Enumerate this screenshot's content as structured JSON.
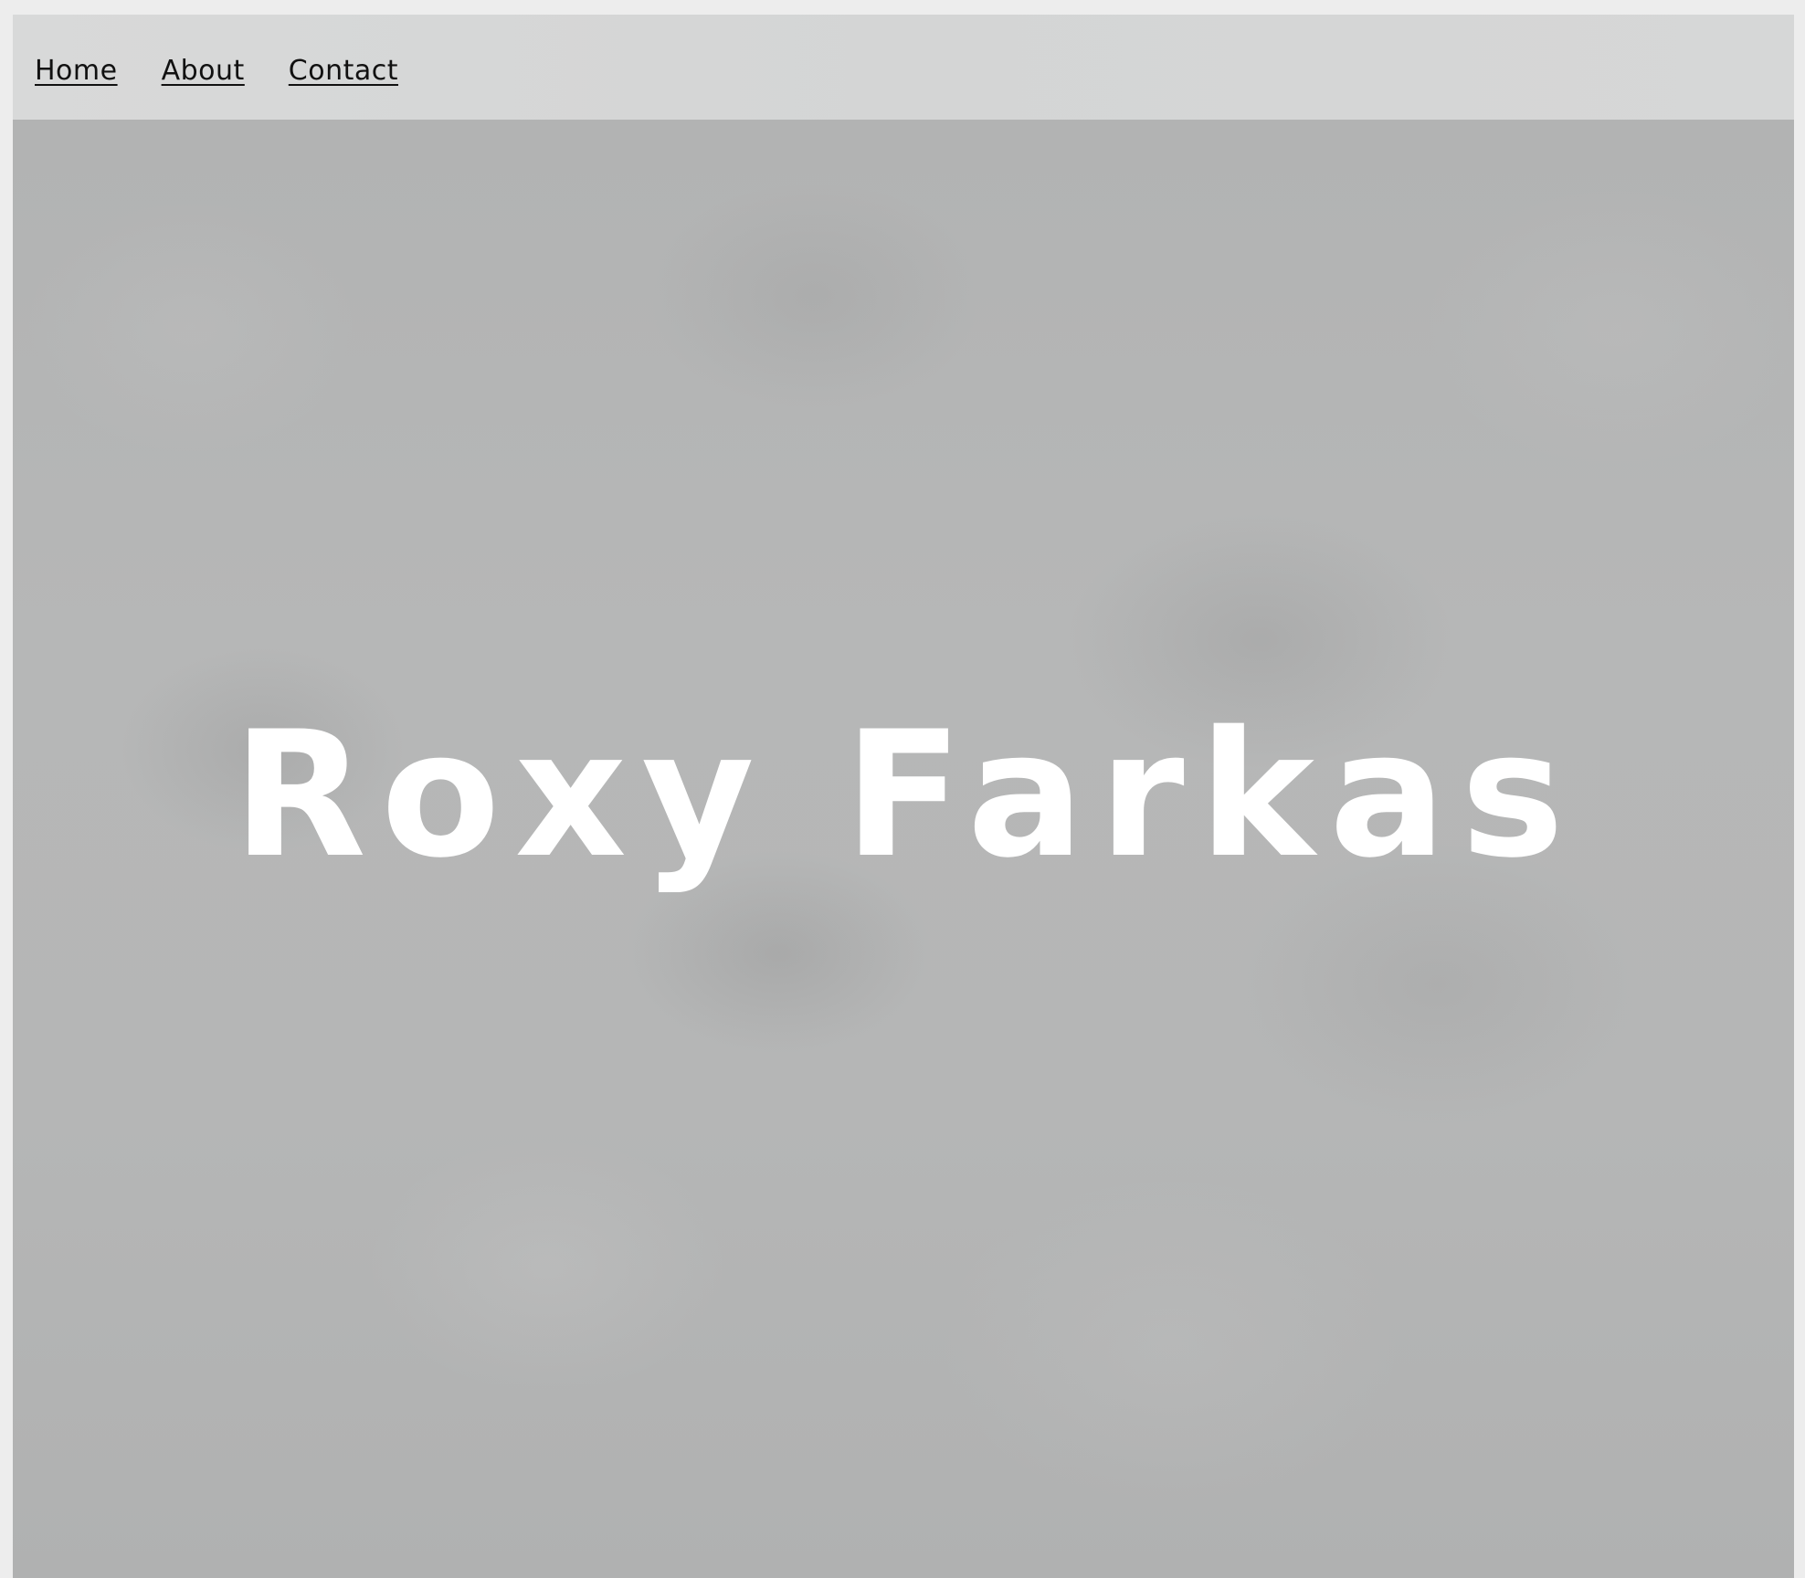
{
  "nav": {
    "links": [
      {
        "label": "Home"
      },
      {
        "label": "About"
      },
      {
        "label": "Contact"
      }
    ]
  },
  "hero": {
    "title": "Roxy Farkas"
  },
  "colors": {
    "navbar_bg": "#d6d7d7",
    "hero_bg": "#b4b5b5",
    "title_color": "#ffffff",
    "link_color": "#111111"
  }
}
